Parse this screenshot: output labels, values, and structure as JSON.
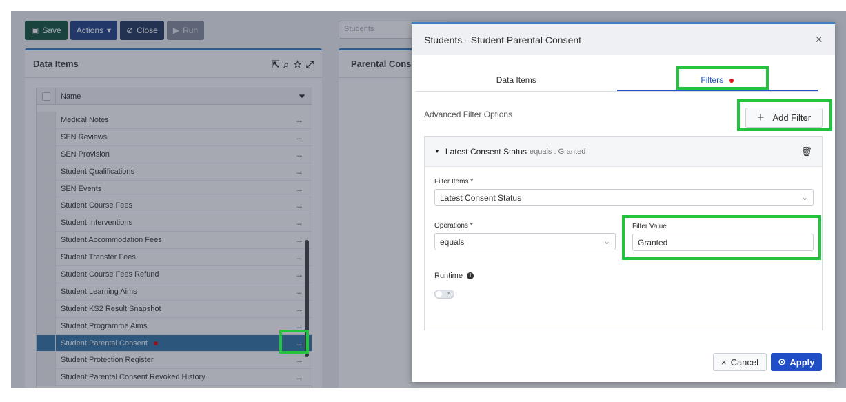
{
  "toolbar": {
    "save_label": "Save",
    "actions_label": "Actions",
    "close_label": "Close",
    "run_label": "Run"
  },
  "background": {
    "search_placeholder": "Students",
    "right_panel_title": "Parental Cons"
  },
  "left_panel": {
    "title": "Data Items",
    "column_header": "Name",
    "items": [
      {
        "label": "Medical Notes",
        "selected": false
      },
      {
        "label": "SEN Reviews",
        "selected": false
      },
      {
        "label": "SEN Provision",
        "selected": false
      },
      {
        "label": "Student Qualifications",
        "selected": false
      },
      {
        "label": "SEN Events",
        "selected": false
      },
      {
        "label": "Student Course Fees",
        "selected": false
      },
      {
        "label": "Student Interventions",
        "selected": false
      },
      {
        "label": "Student Accommodation Fees",
        "selected": false
      },
      {
        "label": "Student Transfer Fees",
        "selected": false
      },
      {
        "label": "Student Course Fees Refund",
        "selected": false
      },
      {
        "label": "Student Learning Aims",
        "selected": false
      },
      {
        "label": "Student KS2 Result Snapshot",
        "selected": false
      },
      {
        "label": "Student Programme Aims",
        "selected": false
      },
      {
        "label": "Student Parental Consent",
        "selected": true
      },
      {
        "label": "Student Protection Register",
        "selected": false
      },
      {
        "label": "Student Parental Consent Revoked History",
        "selected": false
      }
    ]
  },
  "modal": {
    "title": "Students - Student Parental Consent",
    "tabs": [
      "Data Items",
      "Filters"
    ],
    "advanced_label": "Advanced Filter Options",
    "add_filter_label": "Add Filter",
    "filter": {
      "name": "Latest Consent Status",
      "summary": "equals : Granted",
      "filter_items_label": "Filter Items *",
      "filter_items_value": "Latest Consent Status",
      "operations_label": "Operations *",
      "operations_value": "equals",
      "filter_value_label": "Filter Value",
      "filter_value": "Granted",
      "runtime_label": "Runtime"
    },
    "cancel_label": "Cancel",
    "apply_label": "Apply"
  },
  "colors": {
    "accent": "#1f4ec7",
    "highlight": "#22c43e",
    "selected_row": "#3a7aa8",
    "dot": "#dd1111"
  }
}
